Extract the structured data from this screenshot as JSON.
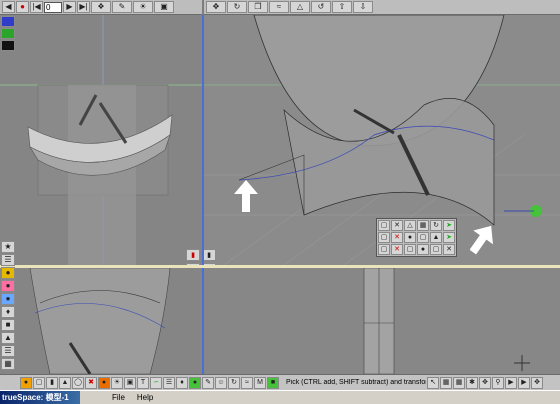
{
  "top_toolbar": {
    "frame_value": "0"
  },
  "status": {
    "hint": "Pick (CTRL add, SHIFT subtract) and transform (LMB in XY plane, RMB"
  },
  "taskbar": {
    "title": "trueSpace: 模型-1",
    "menu": [
      {
        "label": "File"
      },
      {
        "label": "Help"
      }
    ]
  },
  "icons": {
    "record": "record-icon",
    "play": "play-icon",
    "rewind": "rewind-icon",
    "forward": "forward-icon",
    "end": "end-icon",
    "object_tool": "object-tool-icon",
    "arrow_up": "arrow-up-icon"
  },
  "colors": {
    "viewport_bg": "#848484",
    "divider_blue": "#4a6fd8",
    "divider_yellow": "#e9e4bc",
    "highlight_green": "#45c13a"
  }
}
